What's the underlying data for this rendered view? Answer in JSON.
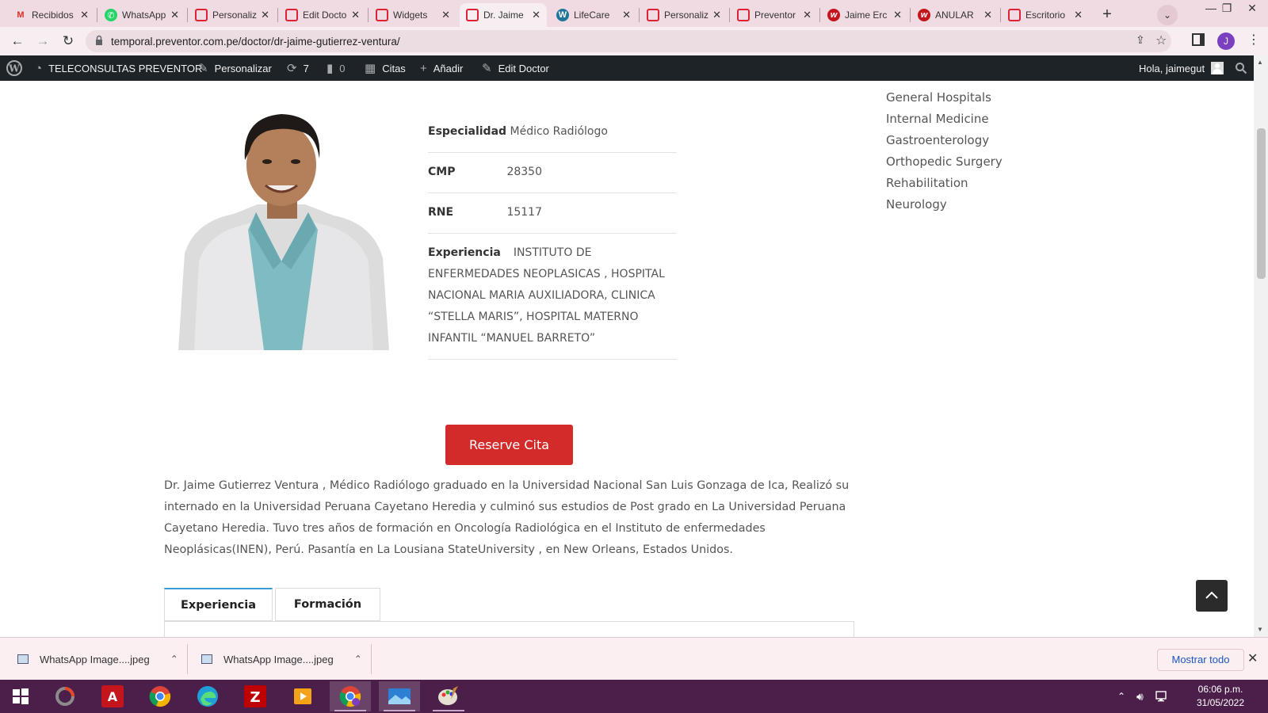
{
  "browser": {
    "tabs": [
      {
        "title": "Recibidos",
        "icon": "gmail-icon"
      },
      {
        "title": "WhatsApp",
        "icon": "whatsapp-icon"
      },
      {
        "title": "Personaliz",
        "icon": "page-icon"
      },
      {
        "title": "Edit Docto",
        "icon": "page-icon"
      },
      {
        "title": "Widgets",
        "icon": "page-icon"
      },
      {
        "title": "Dr. Jaime",
        "icon": "page-icon"
      },
      {
        "title": "LifeCare",
        "icon": "wordpress-icon"
      },
      {
        "title": "Personaliz",
        "icon": "page-icon"
      },
      {
        "title": "Preventor",
        "icon": "page-icon"
      },
      {
        "title": "Jaime Erc",
        "icon": "brand-w-icon"
      },
      {
        "title": "ANULAR",
        "icon": "brand-w-icon"
      },
      {
        "title": "Escritorio",
        "icon": "page-icon"
      }
    ],
    "active_tab_index": 5,
    "url": "temporal.preventor.com.pe/doctor/dr-jaime-gutierrez-ventura/",
    "profile_initial": "J"
  },
  "adminbar": {
    "site_name": "TELECONSULTAS PREVENTOR",
    "customize": "Personalizar",
    "updates_count": "7",
    "comments_count": "0",
    "appointments": "Citas",
    "add_new": "Añadir",
    "edit_doctor": "Edit Doctor",
    "greeting": "Hola, jaimegut"
  },
  "doctor": {
    "fields": [
      {
        "label": "Especialidad",
        "value": "Médico Radiólogo"
      },
      {
        "label": "CMP",
        "value": "28350"
      },
      {
        "label": "RNE",
        "value": "15117"
      },
      {
        "label": "Experiencia",
        "value": "INSTITUTO DE ENFERMEDADES NEOPLASICAS , HOSPITAL NACIONAL MARIA AUXILIADORA, CLINICA “STELLA MARIS”, HOSPITAL MATERNO INFANTIL “MANUEL BARRETO”"
      }
    ],
    "reserve_button": "Reserve Cita",
    "bio": "Dr. Jaime Gutierrez Ventura , Médico Radiólogo graduado en la Universidad Nacional San Luis Gonzaga de Ica, Realizó su internado en la Universidad Peruana Cayetano Heredia y culminó sus estudios de Post grado en La Universidad Peruana Cayetano Heredia. Tuvo tres años de formación en Oncología Radiológica en el Instituto de enfermedades Neoplásicas(INEN), Perú. Pasantía en La Lousiana StateUniversity , en New Orleans, Estados Unidos.",
    "tabs": [
      "Experiencia",
      "Formación"
    ]
  },
  "sidebar": {
    "departments": [
      "General Hospitals",
      "Internal Medicine",
      "Gastroenterology",
      "Orthopedic Surgery",
      "Rehabilitation",
      "Neurology"
    ]
  },
  "downloads": {
    "items": [
      "WhatsApp Image....jpeg",
      "WhatsApp Image....jpeg"
    ],
    "show_all": "Mostrar todo"
  },
  "taskbar": {
    "time": "06:06 p.m.",
    "date": "31/05/2022"
  },
  "colors": {
    "accent_button": "#d32a2a",
    "adminbar": "#1d2327",
    "tab_strip": "#f0dbe2",
    "taskbar": "#4c1f4b"
  }
}
